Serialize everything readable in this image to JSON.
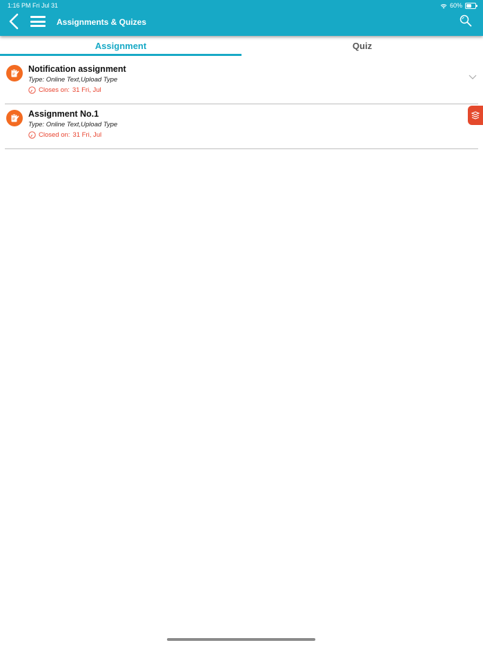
{
  "status_bar": {
    "time_date": "1:16 PM   Fri Jul 31",
    "battery": "60%",
    "battery_level": 0.6
  },
  "header": {
    "title": "Assignments & Quizes",
    "icons": [
      "back-icon",
      "menu-icon",
      "search-icon"
    ]
  },
  "tabs": [
    {
      "label": "Assignment",
      "active": true
    },
    {
      "label": "Quiz",
      "active": false
    }
  ],
  "assignments": [
    {
      "name": "Notification assignment",
      "type": "Type: Online Text,Upload Type",
      "deadline_label": "Closes on:",
      "deadline_value": "31 Fri, Jul"
    },
    {
      "name": "Assignment No.1",
      "type": "Type: Online Text,Upload Type",
      "deadline_label": "Closed on:",
      "deadline_value": "31 Fri, Jul"
    }
  ],
  "colors": {
    "primary": "#17a9c6",
    "badge": "#f36b21",
    "deadline": "#e8412c",
    "side_tab": "#e4492c"
  }
}
